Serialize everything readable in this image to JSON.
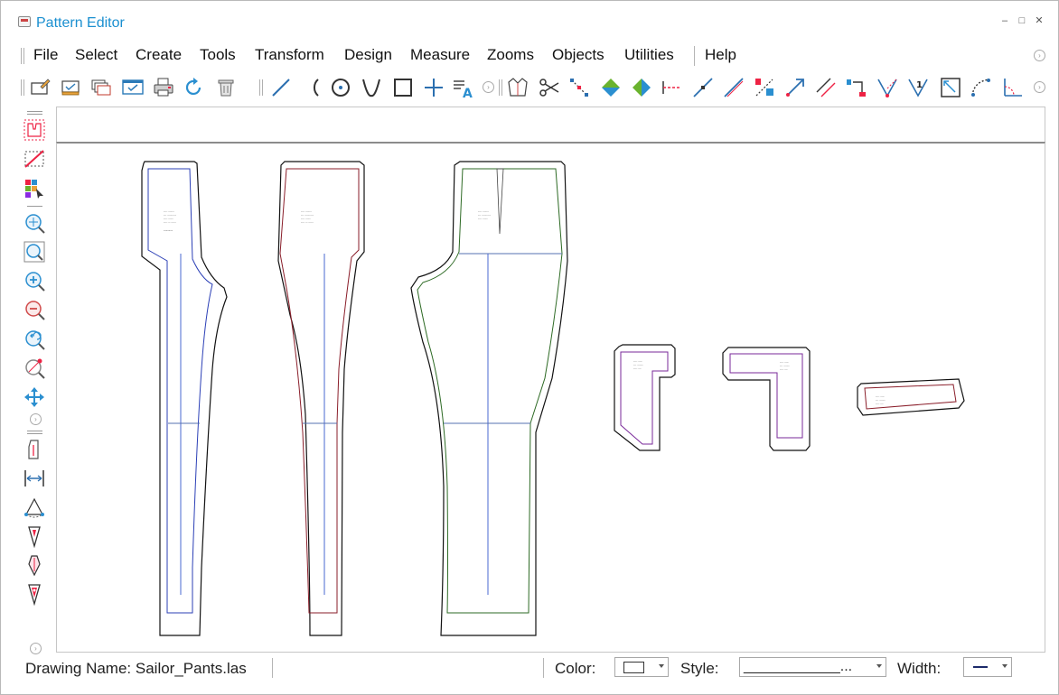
{
  "window": {
    "title": "Pattern Editor",
    "minimize_glyph": "‒",
    "maximize_glyph": "□",
    "close_glyph": "✕"
  },
  "menu": {
    "items": [
      "File",
      "Select",
      "Create",
      "Tools",
      "Transform",
      "Design",
      "Measure",
      "Zooms",
      "Objects",
      "Utilities",
      "Help"
    ]
  },
  "toolbar": {
    "icons": [
      "new-pattern-icon",
      "open-icon",
      "layers-icon",
      "check-window-icon",
      "print-icon",
      "redo-icon",
      "trash-icon",
      "line-icon",
      "arc-icon",
      "circle-point-icon",
      "v-curve-icon",
      "rectangle-icon",
      "plus-icon",
      "text-icon",
      "shirt-icon",
      "scissors-icon",
      "point-path-icon",
      "diamond-green-icon",
      "diamond-split-icon",
      "notch-line-icon",
      "slash-line-icon",
      "diagonal-line-icon",
      "percent-points-icon",
      "arrow-up-right-icon",
      "parallel-lines-icon",
      "corner-point-icon",
      "dart-icon",
      "dart-1-icon",
      "resize-box-icon",
      "dotted-curve-icon",
      "angle-icon"
    ]
  },
  "left_toolbar": {
    "icons": [
      "pattern-pieces-icon",
      "deselect-icon",
      "color-grid-icon",
      "zoom-fit-icon",
      "zoom-window-icon",
      "zoom-in-icon",
      "zoom-out-icon",
      "zoom-previous-icon",
      "zoom-point-icon",
      "pan-icon",
      "piece-icon",
      "measure-width-icon",
      "cone-icon",
      "pin-icon",
      "pin-outline-icon",
      "pin-filled-icon"
    ]
  },
  "status": {
    "drawing_name": "Drawing Name: Sailor_Pants.las",
    "color_label": "Color:",
    "style_label": "Style:",
    "style_value": "____________...",
    "width_label": "Width:"
  },
  "colors": {
    "accent_title": "#1a8fd0",
    "piece_blue": "#2b3fb6",
    "piece_red": "#8a1e2a",
    "piece_green": "#2d6a24",
    "piece_purple": "#7a2a9a",
    "grain_blue": "#4a6ad0"
  }
}
